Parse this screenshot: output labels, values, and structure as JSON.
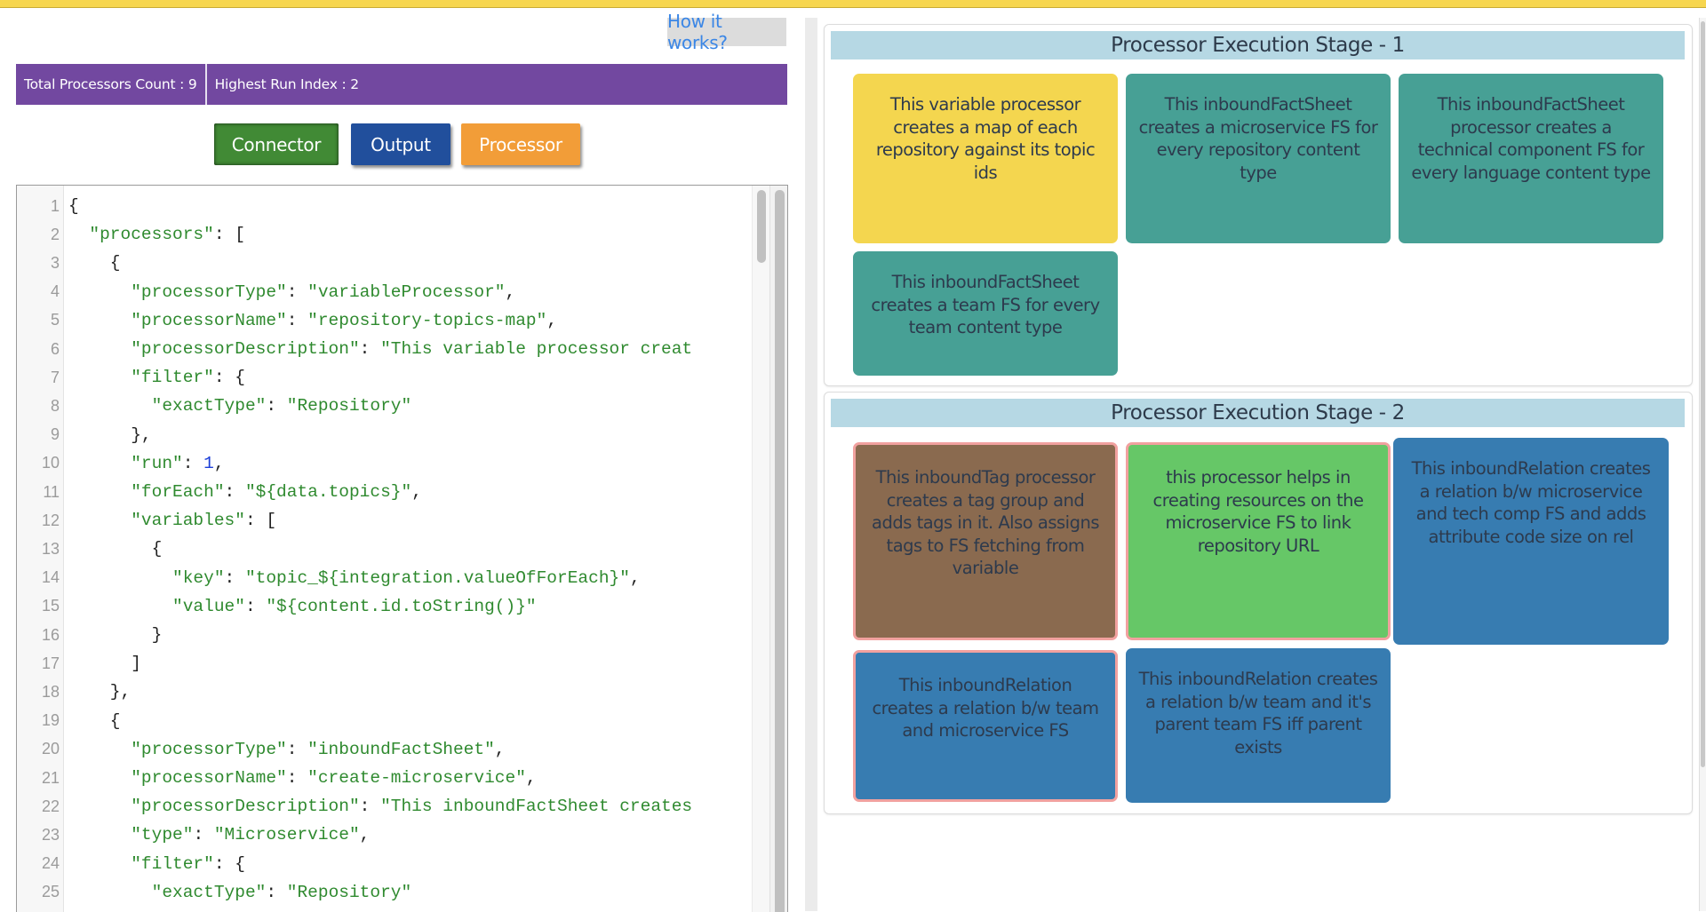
{
  "header": {
    "how_it_works_label": "How it works?"
  },
  "stats": {
    "total_processors": "Total Processors Count : 9",
    "highest_run_index": "Highest Run Index : 2"
  },
  "toolbar": {
    "connector_label": "Connector",
    "output_label": "Output",
    "processor_label": "Processor"
  },
  "editor": {
    "lines": [
      {
        "n": "1",
        "tokens": [
          [
            "p",
            "{"
          ]
        ]
      },
      {
        "n": "2",
        "tokens": [
          [
            "p",
            "  "
          ],
          [
            "key",
            "\"processors\""
          ],
          [
            "p",
            ": ["
          ]
        ]
      },
      {
        "n": "3",
        "tokens": [
          [
            "p",
            "    {"
          ]
        ]
      },
      {
        "n": "4",
        "tokens": [
          [
            "p",
            "      "
          ],
          [
            "key",
            "\"processorType\""
          ],
          [
            "p",
            ": "
          ],
          [
            "str",
            "\"variableProcessor\""
          ],
          [
            "p",
            ","
          ]
        ]
      },
      {
        "n": "5",
        "tokens": [
          [
            "p",
            "      "
          ],
          [
            "key",
            "\"processorName\""
          ],
          [
            "p",
            ": "
          ],
          [
            "str",
            "\"repository-topics-map\""
          ],
          [
            "p",
            ","
          ]
        ]
      },
      {
        "n": "6",
        "tokens": [
          [
            "p",
            "      "
          ],
          [
            "key",
            "\"processorDescription\""
          ],
          [
            "p",
            ": "
          ],
          [
            "str",
            "\"This variable processor creat"
          ]
        ]
      },
      {
        "n": "7",
        "tokens": [
          [
            "p",
            "      "
          ],
          [
            "key",
            "\"filter\""
          ],
          [
            "p",
            ": {"
          ]
        ]
      },
      {
        "n": "8",
        "tokens": [
          [
            "p",
            "        "
          ],
          [
            "key",
            "\"exactType\""
          ],
          [
            "p",
            ": "
          ],
          [
            "str",
            "\"Repository\""
          ]
        ]
      },
      {
        "n": "9",
        "tokens": [
          [
            "p",
            "      },"
          ]
        ]
      },
      {
        "n": "10",
        "tokens": [
          [
            "p",
            "      "
          ],
          [
            "key",
            "\"run\""
          ],
          [
            "p",
            ": "
          ],
          [
            "num",
            "1"
          ],
          [
            "p",
            ","
          ]
        ]
      },
      {
        "n": "11",
        "tokens": [
          [
            "p",
            "      "
          ],
          [
            "key",
            "\"forEach\""
          ],
          [
            "p",
            ": "
          ],
          [
            "str",
            "\"${data.topics}\""
          ],
          [
            "p",
            ","
          ]
        ]
      },
      {
        "n": "12",
        "tokens": [
          [
            "p",
            "      "
          ],
          [
            "key",
            "\"variables\""
          ],
          [
            "p",
            ": ["
          ]
        ]
      },
      {
        "n": "13",
        "tokens": [
          [
            "p",
            "        {"
          ]
        ]
      },
      {
        "n": "14",
        "tokens": [
          [
            "p",
            "          "
          ],
          [
            "key",
            "\"key\""
          ],
          [
            "p",
            ": "
          ],
          [
            "str",
            "\"topic_${integration.valueOfForEach}\""
          ],
          [
            "p",
            ","
          ]
        ]
      },
      {
        "n": "15",
        "tokens": [
          [
            "p",
            "          "
          ],
          [
            "key",
            "\"value\""
          ],
          [
            "p",
            ": "
          ],
          [
            "str",
            "\"${content.id.toString()}\""
          ]
        ]
      },
      {
        "n": "16",
        "tokens": [
          [
            "p",
            "        }"
          ]
        ]
      },
      {
        "n": "17",
        "tokens": [
          [
            "p",
            "      ]"
          ]
        ]
      },
      {
        "n": "18",
        "tokens": [
          [
            "p",
            "    },"
          ]
        ]
      },
      {
        "n": "19",
        "tokens": [
          [
            "p",
            "    {"
          ]
        ]
      },
      {
        "n": "20",
        "tokens": [
          [
            "p",
            "      "
          ],
          [
            "key",
            "\"processorType\""
          ],
          [
            "p",
            ": "
          ],
          [
            "str",
            "\"inboundFactSheet\""
          ],
          [
            "p",
            ","
          ]
        ]
      },
      {
        "n": "21",
        "tokens": [
          [
            "p",
            "      "
          ],
          [
            "key",
            "\"processorName\""
          ],
          [
            "p",
            ": "
          ],
          [
            "str",
            "\"create-microservice\""
          ],
          [
            "p",
            ","
          ]
        ]
      },
      {
        "n": "22",
        "tokens": [
          [
            "p",
            "      "
          ],
          [
            "key",
            "\"processorDescription\""
          ],
          [
            "p",
            ": "
          ],
          [
            "str",
            "\"This inboundFactSheet creates"
          ]
        ]
      },
      {
        "n": "23",
        "tokens": [
          [
            "p",
            "      "
          ],
          [
            "key",
            "\"type\""
          ],
          [
            "p",
            ": "
          ],
          [
            "str",
            "\"Microservice\""
          ],
          [
            "p",
            ","
          ]
        ]
      },
      {
        "n": "24",
        "tokens": [
          [
            "p",
            "      "
          ],
          [
            "key",
            "\"filter\""
          ],
          [
            "p",
            ": {"
          ]
        ]
      },
      {
        "n": "25",
        "tokens": [
          [
            "p",
            "        "
          ],
          [
            "key",
            "\"exactType\""
          ],
          [
            "p",
            ": "
          ],
          [
            "str",
            "\"Repository\""
          ]
        ]
      }
    ]
  },
  "stages": [
    {
      "title": "Processor Execution Stage - 1",
      "cards": [
        {
          "text": "This variable processor creates a map of each repository against its topic ids",
          "color": "#f4d64f",
          "selected": false
        },
        {
          "text": "This inboundFactSheet creates a microservice FS for every repository content type",
          "color": "#47a095",
          "selected": false
        },
        {
          "text": "This inboundFactSheet processor creates a technical component FS for every language content type",
          "color": "#47a095",
          "selected": false
        },
        {
          "text": "This inboundFactSheet creates a team FS for every team content type",
          "color": "#47a095",
          "selected": false
        }
      ]
    },
    {
      "title": "Processor Execution Stage - 2",
      "cards": [
        {
          "text": "This inboundTag processor creates a tag group and adds tags in it. Also assigns tags to FS fetching from variable",
          "color": "#8a6a4f",
          "selected": true
        },
        {
          "text": "this processor helps in creating resources on the microservice FS to link repository URL",
          "color": "#66c767",
          "selected": true
        },
        {
          "text": "This inboundRelation creates a relation b/w microservice and tech comp FS and adds attribute code size on rel",
          "color": "#377cb1",
          "selected": false
        },
        {
          "text": "This inboundRelation creates a relation b/w team and microservice FS",
          "color": "#377cb1",
          "selected": true
        },
        {
          "text": "This inboundRelation creates a relation b/w team and it's parent team FS iff parent exists",
          "color": "#377cb1",
          "selected": false
        }
      ]
    }
  ]
}
